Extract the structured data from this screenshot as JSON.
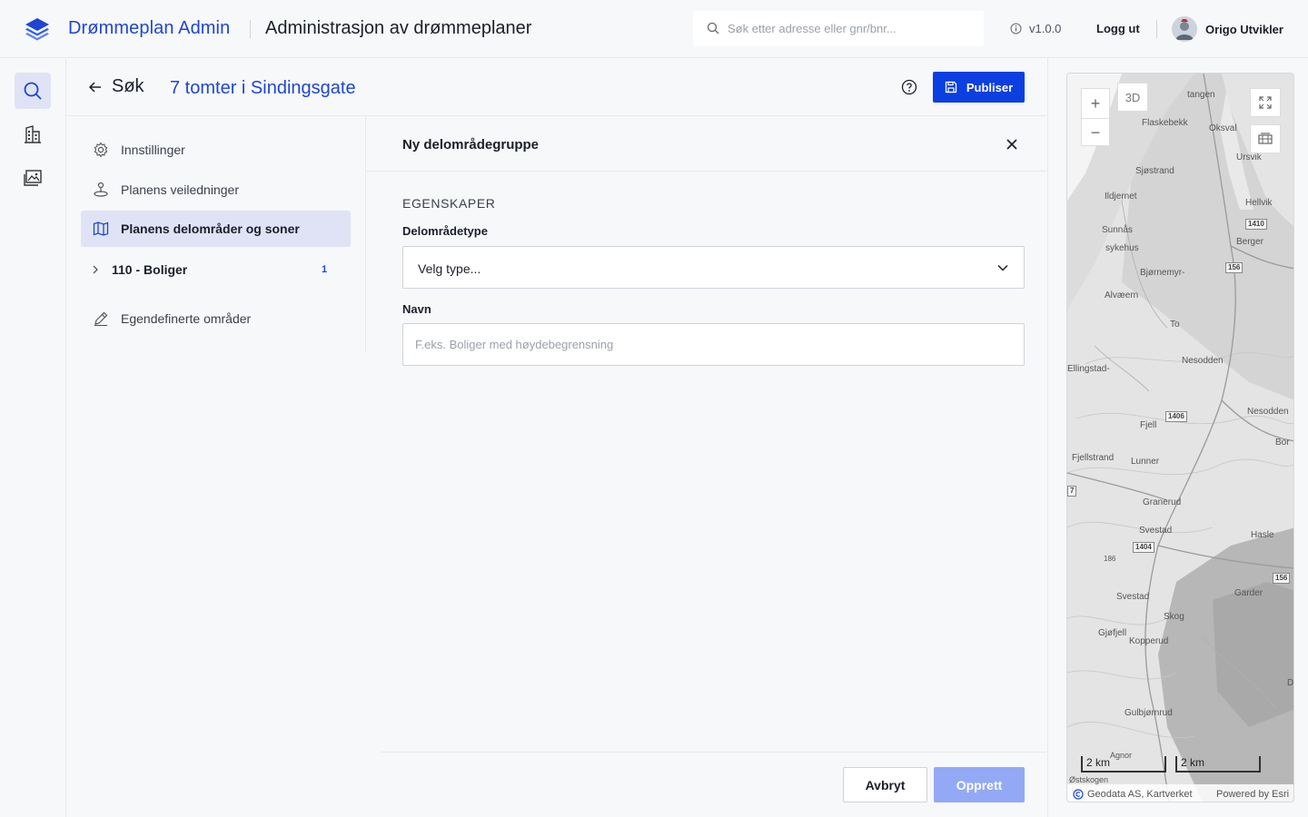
{
  "brand": {
    "name": "Drømmeplan Admin",
    "app_title": "Administrasjon av drømmeplaner"
  },
  "search": {
    "placeholder": "Søk etter adresse eller gnr/bnr..."
  },
  "topbar": {
    "version": "v1.0.0",
    "logout": "Logg ut",
    "user_name": "Origo Utvikler"
  },
  "rail": {
    "items": [
      {
        "icon": "search-icon"
      },
      {
        "icon": "buildings-icon"
      },
      {
        "icon": "images-icon"
      }
    ]
  },
  "header": {
    "back_label": "Søk",
    "plan_name": "7 tomter i Sindingsgate",
    "publish_label": "Publiser"
  },
  "sidenav": {
    "items": [
      {
        "label": "Innstillinger",
        "icon": "gear-icon"
      },
      {
        "label": "Planens veiledninger",
        "icon": "guide-icon"
      },
      {
        "label": "Planens delområder og soner",
        "icon": "map-icon",
        "active": true
      },
      {
        "label": "110 - Boliger",
        "icon": "chevron-right-icon",
        "badge": "1"
      },
      {
        "label": "Egendefinerte områder",
        "icon": "pencil-icon"
      }
    ]
  },
  "form": {
    "title": "Ny delområdegruppe",
    "section": "EGENSKAPER",
    "type_label": "Delområdetype",
    "type_value": "Velg type...",
    "name_label": "Navn",
    "name_placeholder": "F.eks. Boliger med høydebegrensning",
    "cancel_label": "Avbryt",
    "create_label": "Opprett"
  },
  "map": {
    "btn_3d": "3D",
    "zoom_in": "+",
    "zoom_out": "−",
    "places": [
      "tangen",
      "Flaskebekk",
      "Oksval",
      "Ursvik",
      "Sjøstrand",
      "Ildjernet",
      "Hellvik",
      "Sunnås",
      "sykehus",
      "Berger",
      "Bjørnemyr-",
      "Alvæern",
      "To",
      "Nesodden",
      "Ellingstad-",
      "Nesodden",
      "Fjell",
      "Bor",
      "Fjellstrand",
      "Lunner",
      "Granerud",
      "Svestad",
      "Hasle",
      "186",
      "Svestad",
      "Garder",
      "Skog",
      "Gjøfjell",
      "Kopperud",
      "D",
      "Gulbjørnrud",
      "Agnor",
      "Østskogen"
    ],
    "roads": [
      "1410",
      "156",
      "1406",
      "1404",
      "156",
      "7"
    ],
    "scale_labels": [
      "2 km",
      "2 km"
    ],
    "attribution": "Geodata AS, Kartverket",
    "powered_by": "Powered by Esri"
  },
  "colors": {
    "accent": "#1e45d6",
    "primary_button": "#0b3fe0",
    "disabled_button": "#93a9f6",
    "active_bg": "#dfe3f5"
  }
}
